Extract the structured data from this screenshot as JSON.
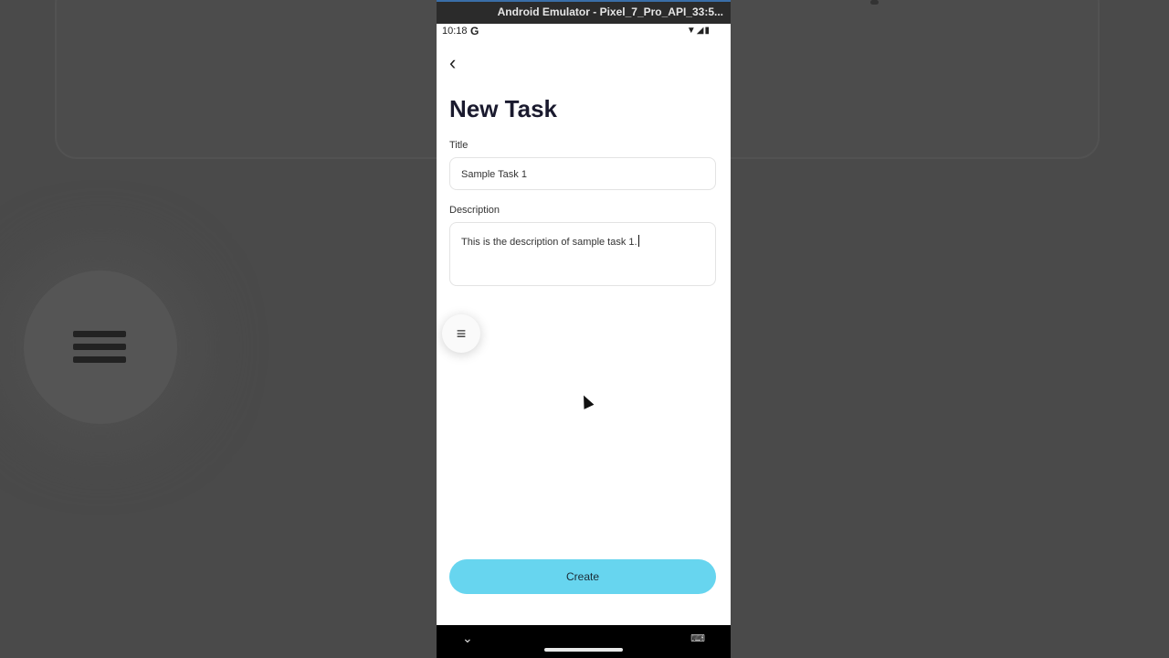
{
  "window": {
    "title": "Android Emulator - Pixel_7_Pro_API_33:5..."
  },
  "statusbar": {
    "time": "10:18",
    "g_label": "G",
    "system_icons": "▼◢▮"
  },
  "page": {
    "title": "New Task"
  },
  "form": {
    "title_label": "Title",
    "title_value": "Sample Task 1",
    "description_label": "Description",
    "description_value": "This is the description of sample task 1."
  },
  "actions": {
    "create_label": "Create"
  },
  "icons": {
    "back": "chevron-left",
    "fab": "menu",
    "nav_hide": "chevron-down",
    "keyboard": "keyboard"
  },
  "colors": {
    "accent": "#67d5ef",
    "title_text": "#1a1a2e"
  }
}
